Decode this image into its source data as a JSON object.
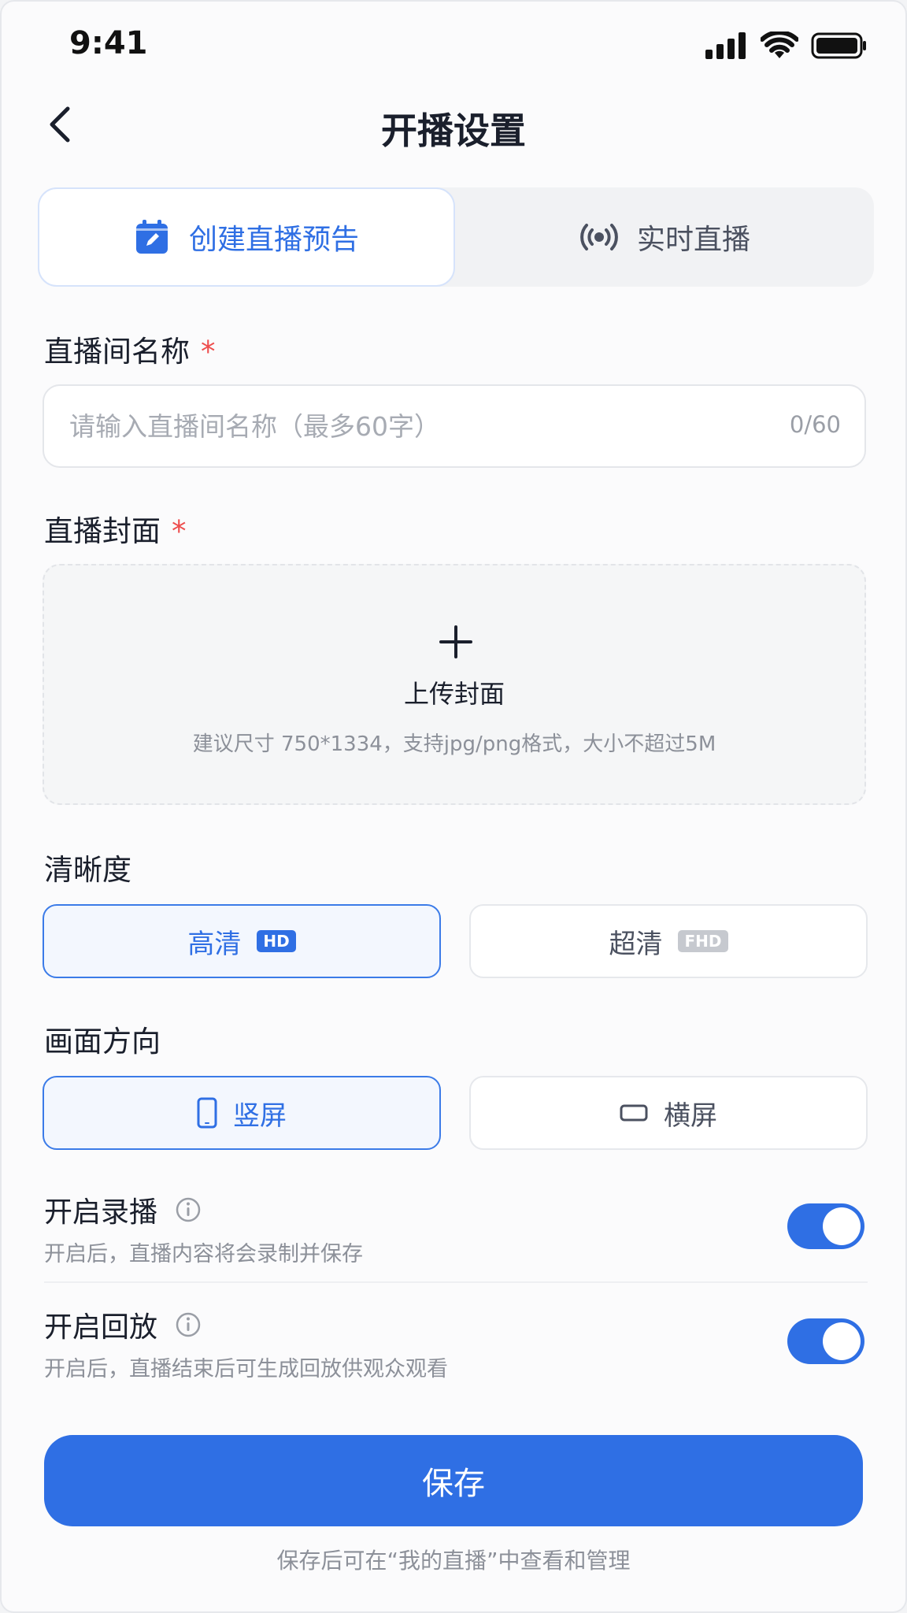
{
  "status_bar": {
    "time": "9:41"
  },
  "nav": {
    "title": "开播设置"
  },
  "tabs": [
    {
      "label": "创建直播预告",
      "active": true,
      "icon": "calendar-edit-icon"
    },
    {
      "label": "实时直播",
      "active": false,
      "icon": "broadcast-icon"
    }
  ],
  "room_name": {
    "label": "直播间名称",
    "required_mark": "*",
    "placeholder": "请输入直播间名称（最多60字）",
    "value": "",
    "counter": "0/60"
  },
  "cover": {
    "label": "直播封面",
    "required_mark": "*",
    "upload_label": "上传封面",
    "hint": "建议尺寸 750*1334，支持jpg/png格式，大小不超过5M"
  },
  "quality": {
    "label": "清晰度",
    "options": [
      {
        "label": "高清",
        "badge": "HD",
        "selected": true
      },
      {
        "label": "超清",
        "badge": "FHD",
        "selected": false
      }
    ]
  },
  "orientation": {
    "label": "画面方向",
    "options": [
      {
        "label": "竖屏",
        "icon": "portrait-icon",
        "selected": true
      },
      {
        "label": "横屏",
        "icon": "landscape-icon",
        "selected": false
      }
    ]
  },
  "recording": {
    "title": "开启录播",
    "desc": "开启后，直播内容将会录制并保存",
    "enabled": true
  },
  "playback": {
    "title": "开启回放",
    "desc": "开启后，直播结束后可生成回放供观众观看",
    "enabled": true
  },
  "save_button": {
    "label": "保存"
  },
  "footer_note": "保存后可在“我的直播”中查看和管理",
  "colors": {
    "accent": "#2f6fe4",
    "required": "#ee4d4d",
    "toggle_on": "#2f6fe4"
  }
}
